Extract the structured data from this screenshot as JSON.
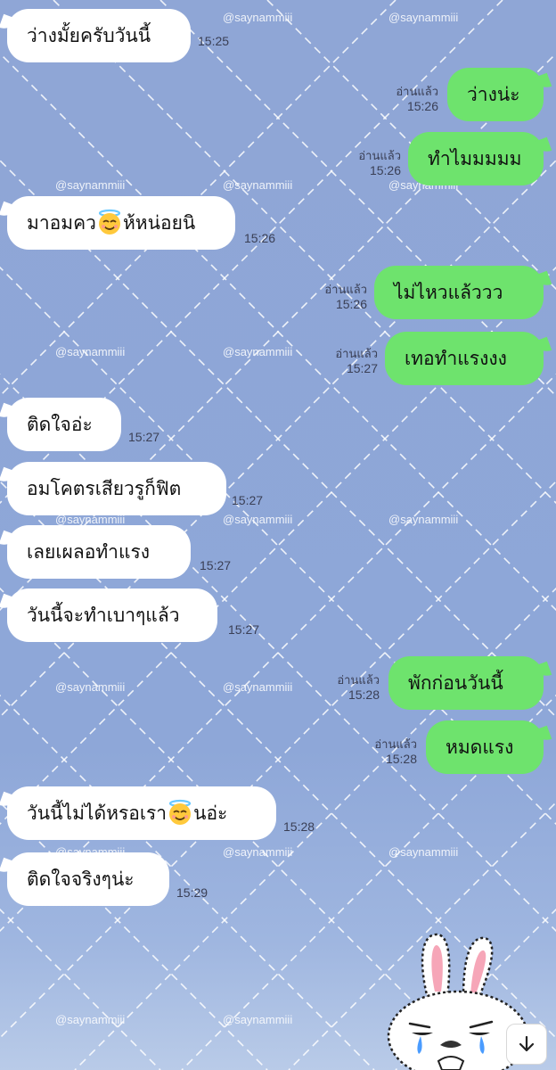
{
  "watermark_text": "@saynammiii",
  "read_label": "อ่านแล้ว",
  "messages": [
    {
      "dir": "in",
      "text": "ว่างมั้ยครับวันนี้",
      "time": "15:25"
    },
    {
      "dir": "out",
      "text": "ว่างน่ะ",
      "time": "15:26",
      "read": "อ่านแล้ว"
    },
    {
      "dir": "out",
      "text": "ทำไมมมมม",
      "time": "15:26",
      "read": "อ่านแล้ว"
    },
    {
      "dir": "in",
      "text_before": "มาอมคว",
      "text_after": "ห้หน่อยนิ",
      "emoji": "halo-smile-emoji",
      "time": "15:26"
    },
    {
      "dir": "out",
      "text": "ไม่ไหวแล้ววว",
      "time": "15:26",
      "read": "อ่านแล้ว"
    },
    {
      "dir": "out",
      "text": "เทอทำแรงงง",
      "time": "15:27",
      "read": "อ่านแล้ว"
    },
    {
      "dir": "in",
      "text": "ติดใจอ่ะ",
      "time": "15:27"
    },
    {
      "dir": "in",
      "text": "อมโคตรเสียวรูก็ฟิต",
      "time": "15:27"
    },
    {
      "dir": "in",
      "text": "เลยเผลอทำแรง",
      "time": "15:27"
    },
    {
      "dir": "in",
      "text": "วันนี้จะทำเบาๆแล้ว",
      "time": "15:27"
    },
    {
      "dir": "out",
      "text": "พักก่อนวันนี้",
      "time": "15:28",
      "read": "อ่านแล้ว"
    },
    {
      "dir": "out",
      "text": "หมดแรง",
      "time": "15:28",
      "read": "อ่านแล้ว"
    },
    {
      "dir": "in",
      "text_before": "วันนี้ไม่ได้หรอเรา",
      "text_after": "นอ่ะ",
      "emoji": "halo-smile-emoji",
      "time": "15:28"
    },
    {
      "dir": "in",
      "text": "ติดใจจริงๆน่ะ",
      "time": "15:29"
    }
  ],
  "sticker": "crying-bunny-sticker",
  "scroll_button_icon": "arrow-down-icon",
  "colors": {
    "outgoing": "#6ee36d",
    "incoming": "#ffffff",
    "background": "#8fa6d6"
  }
}
